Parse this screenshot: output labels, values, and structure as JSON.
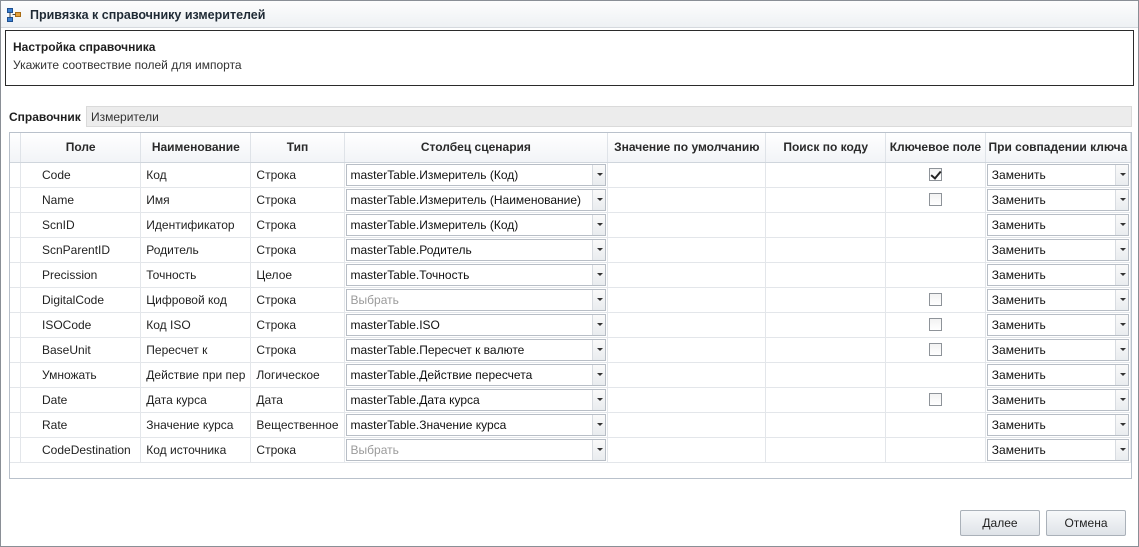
{
  "window": {
    "title": "Привязка к справочнику измерителей"
  },
  "header": {
    "title": "Настройка справочника",
    "subtitle": "Укажите соотвествие полей для импорта"
  },
  "reference": {
    "label": "Справочник",
    "value": "Измерители"
  },
  "columns": {
    "field": "Поле",
    "name": "Наименование",
    "type": "Тип",
    "source": "Столбец сценария",
    "default": "Значение по умолчанию",
    "search": "Поиск по коду",
    "key": "Ключевое поле",
    "onmatch": "При совпадении ключа"
  },
  "rows": [
    {
      "field": "Code",
      "name": "Код",
      "type": "Строка",
      "source": "masterTable.Измеритель (Код)",
      "source_placeholder": false,
      "key_visible": true,
      "key_checked": true,
      "onmatch": "Заменить"
    },
    {
      "field": "Name",
      "name": "Имя",
      "type": "Строка",
      "source": "masterTable.Измеритель (Наименование)",
      "source_placeholder": false,
      "key_visible": true,
      "key_checked": false,
      "onmatch": "Заменить"
    },
    {
      "field": "ScnID",
      "name": "Идентификатор",
      "type": "Строка",
      "source": "masterTable.Измеритель (Код)",
      "source_placeholder": false,
      "key_visible": false,
      "key_checked": false,
      "onmatch": "Заменить"
    },
    {
      "field": "ScnParentID",
      "name": "Родитель",
      "type": "Строка",
      "source": "masterTable.Родитель",
      "source_placeholder": false,
      "key_visible": false,
      "key_checked": false,
      "onmatch": "Заменить"
    },
    {
      "field": "Precission",
      "name": "Точность",
      "type": "Целое",
      "source": "masterTable.Точность",
      "source_placeholder": false,
      "key_visible": false,
      "key_checked": false,
      "onmatch": "Заменить"
    },
    {
      "field": "DigitalCode",
      "name": "Цифровой код",
      "type": "Строка",
      "source": "Выбрать",
      "source_placeholder": true,
      "key_visible": true,
      "key_checked": false,
      "onmatch": "Заменить"
    },
    {
      "field": "ISOCode",
      "name": "Код ISO",
      "type": "Строка",
      "source": "masterTable.ISO",
      "source_placeholder": false,
      "key_visible": true,
      "key_checked": false,
      "onmatch": "Заменить"
    },
    {
      "field": "BaseUnit",
      "name": "Пересчет к",
      "type": "Строка",
      "source": "masterTable.Пересчет к валюте",
      "source_placeholder": false,
      "key_visible": true,
      "key_checked": false,
      "onmatch": "Заменить"
    },
    {
      "field": "Умножать",
      "name": "Действие при пер",
      "type": "Логическое",
      "source": "masterTable.Действие пересчета",
      "source_placeholder": false,
      "key_visible": false,
      "key_checked": false,
      "onmatch": "Заменить"
    },
    {
      "field": "Date",
      "name": "Дата курса",
      "type": "Дата",
      "source": "masterTable.Дата курса",
      "source_placeholder": false,
      "key_visible": true,
      "key_checked": false,
      "onmatch": "Заменить"
    },
    {
      "field": "Rate",
      "name": "Значение курса",
      "type": "Вещественное",
      "source": "masterTable.Значение курса",
      "source_placeholder": false,
      "key_visible": false,
      "key_checked": false,
      "onmatch": "Заменить"
    },
    {
      "field": "CodeDestination",
      "name": "Код источника",
      "type": "Строка",
      "source": "Выбрать",
      "source_placeholder": true,
      "key_visible": false,
      "key_checked": false,
      "onmatch": "Заменить"
    }
  ],
  "buttons": {
    "next": "Далее",
    "cancel": "Отмена"
  }
}
